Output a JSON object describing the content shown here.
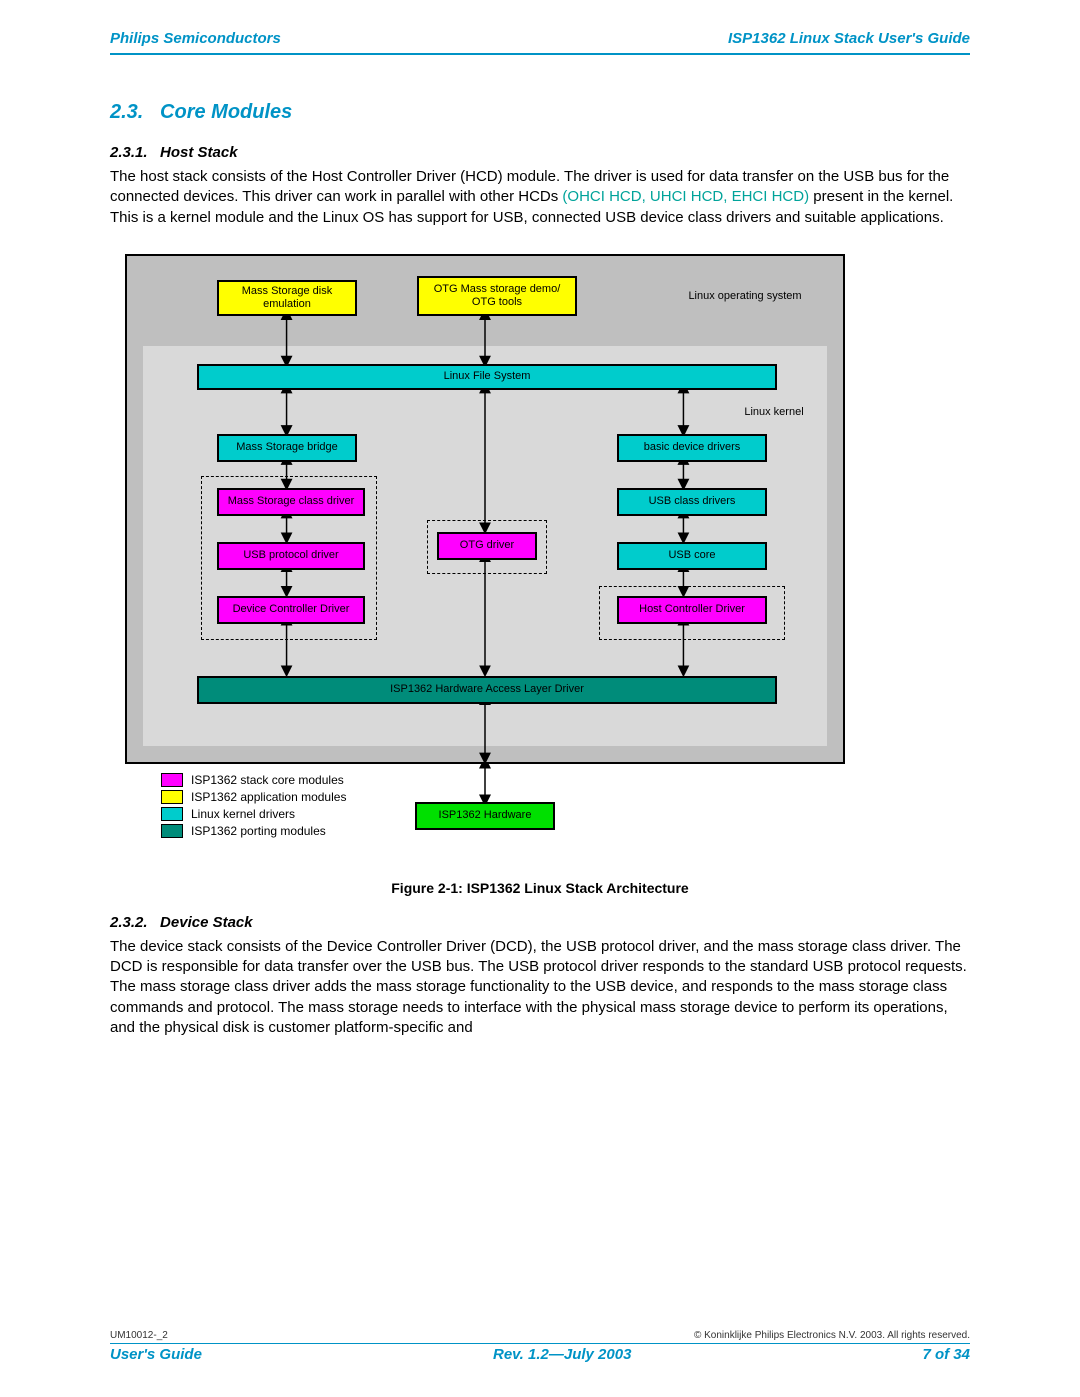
{
  "header": {
    "left": "Philips Semiconductors",
    "right": "ISP1362 Linux Stack User's Guide"
  },
  "section": {
    "number": "2.3.",
    "title": "Core Modules"
  },
  "sub_host": {
    "number": "2.3.1.",
    "title": "Host Stack",
    "p_a": "The host stack consists of the Host Controller Driver (HCD) module. The driver is used for data transfer on the USB bus for the connected devices. This driver can work in parallel with other HCDs ",
    "p_accent": "(OHCI HCD, UHCI HCD, EHCI HCD)",
    "p_b": " present in the kernel. This is a kernel module and the Linux OS has support for USB, connected USB device class drivers and suitable applications."
  },
  "diagram": {
    "os_label": "Linux operating system",
    "kernel_label": "Linux kernel",
    "mass_demo": "Mass Storage disk emulation",
    "otg_demo": "OTG Mass storage demo/\nOTG tools",
    "lfs": "Linux File System",
    "ms_bridge": "Mass Storage bridge",
    "basic_drv": "basic device drivers",
    "ms_class": "Mass Storage class driver",
    "usb_class": "USB class drivers",
    "otg_drv": "OTG driver",
    "usb_proto": "USB protocol driver",
    "usb_core": "USB core",
    "dcd": "Device Controller Driver",
    "hcd": "Host Controller Driver",
    "hal": "ISP1362 Hardware Access Layer Driver",
    "hw": "ISP1362 Hardware"
  },
  "legend": {
    "l0": "ISP1362 stack core modules",
    "l1": "ISP1362 application modules",
    "l2": "Linux kernel drivers",
    "l3": "ISP1362 porting modules"
  },
  "caption": "Figure 2-1: ISP1362 Linux Stack Architecture",
  "sub_device": {
    "number": "2.3.2.",
    "title": "Device Stack",
    "p": "The device stack consists of the Device Controller Driver (DCD), the USB protocol driver, and the mass storage class driver. The DCD is responsible for data transfer over the USB bus. The USB protocol driver responds to the standard USB protocol requests. The mass storage class driver adds the mass storage functionality to the USB device, and responds to the mass storage class commands and protocol. The mass storage needs to interface with the physical mass storage device to perform its operations, and the physical disk is customer platform-specific and"
  },
  "footer": {
    "docnum": "UM10012-_2",
    "copyright": "© Koninklijke Philips Electronics N.V. 2003. All rights reserved.",
    "left": "User's Guide",
    "center": "Rev. 1.2—July 2003",
    "right": "7 of 34"
  }
}
